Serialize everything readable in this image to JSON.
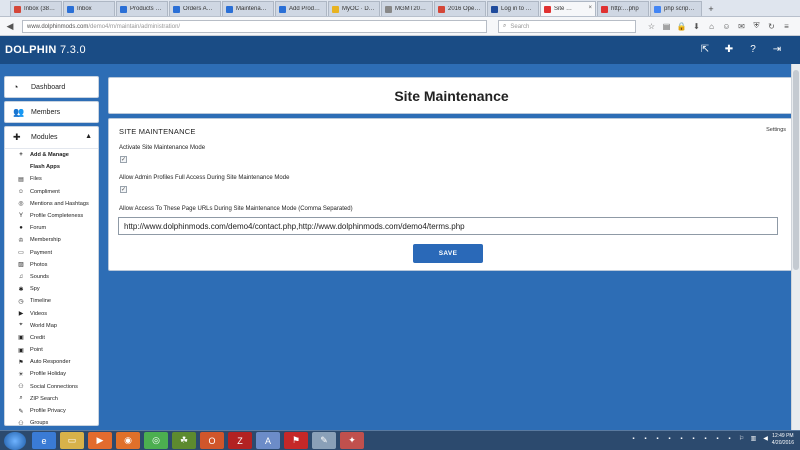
{
  "browser": {
    "tabs": [
      {
        "label": "Inbox (38…",
        "color": "#d44638"
      },
      {
        "label": "Inbox",
        "color": "#2a6fd6"
      },
      {
        "label": "Products …",
        "color": "#2a6fd6"
      },
      {
        "label": "Orders A…",
        "color": "#2a6fd6"
      },
      {
        "label": "Maintena…",
        "color": "#2a6fd6"
      },
      {
        "label": "Add Prod…",
        "color": "#2a6fd6"
      },
      {
        "label": "MyOC · D…",
        "color": "#e8b321"
      },
      {
        "label": "MGMT2065 U…",
        "color": "#888888"
      },
      {
        "label": "2016 Ope…",
        "color": "#d44638"
      },
      {
        "label": "Log in to …",
        "color": "#1f4b9c"
      },
      {
        "label": "Site …",
        "color": "#e03131",
        "active": true
      },
      {
        "label": "http:…php",
        "color": "#e03131"
      },
      {
        "label": "php scrip…",
        "color": "#4285f4"
      }
    ],
    "url_host": "www.dolphinmods.com",
    "url_path": "/demo4/m/maintain/administration/",
    "search_placeholder": "Search"
  },
  "header": {
    "brand": "DOLPHIN",
    "version": "7.3.0"
  },
  "sidebar": {
    "dashboard": "Dashboard",
    "members": "Members",
    "modules": "Modules",
    "items": [
      {
        "label": "Add & Manage",
        "icon": "+",
        "bold": true
      },
      {
        "label": "Flash Apps",
        "icon": "",
        "bold": true
      },
      {
        "label": "Files",
        "icon": "▤"
      },
      {
        "label": "Compliment",
        "icon": "☺"
      },
      {
        "label": "Mentions and Hashtags",
        "icon": "◎"
      },
      {
        "label": "Profile Completeness",
        "icon": "Y"
      },
      {
        "label": "Forum",
        "icon": "●"
      },
      {
        "label": "Membership",
        "icon": "♔"
      },
      {
        "label": "Payment",
        "icon": "▭"
      },
      {
        "label": "Photos",
        "icon": "▨"
      },
      {
        "label": "Sounds",
        "icon": "♫"
      },
      {
        "label": "Spy",
        "icon": "✱"
      },
      {
        "label": "Timeline",
        "icon": "◷"
      },
      {
        "label": "Videos",
        "icon": "▶"
      },
      {
        "label": "World Map",
        "icon": "⌖"
      },
      {
        "label": "Credit",
        "icon": "▣"
      },
      {
        "label": "Point",
        "icon": "▣"
      },
      {
        "label": "Auto Responder",
        "icon": "⚑"
      },
      {
        "label": "Profile Holiday",
        "icon": "☀"
      },
      {
        "label": "Social Connections",
        "icon": "⚇"
      },
      {
        "label": "ZIP Search",
        "icon": "⌕"
      },
      {
        "label": "Profile Privacy",
        "icon": "✎"
      },
      {
        "label": "Groups",
        "icon": "⚇"
      }
    ]
  },
  "main": {
    "page_title": "Site Maintenance",
    "section_title": "SITE MAINTENANCE",
    "settings_link": "Settings",
    "field1_label": "Activate Site Maintenance Mode",
    "field1_checked": true,
    "field2_label": "Allow Admin Profiles Full Access During Site Maintenance Mode",
    "field2_checked": true,
    "field3_label": "Allow Access To These Page URLs During Site Maintenance Mode (Comma Separated)",
    "field3_value": "http://www.dolphinmods.com/demo4/contact.php,http://www.dolphinmods.com/demo4/terms.php",
    "save_label": "SAVE"
  },
  "taskbar": {
    "time": "12:49 PM",
    "date": "4/20/2016"
  },
  "colors": {
    "header": "#1a4c85",
    "background": "#2d6db5",
    "save_button": "#2a69b8"
  }
}
